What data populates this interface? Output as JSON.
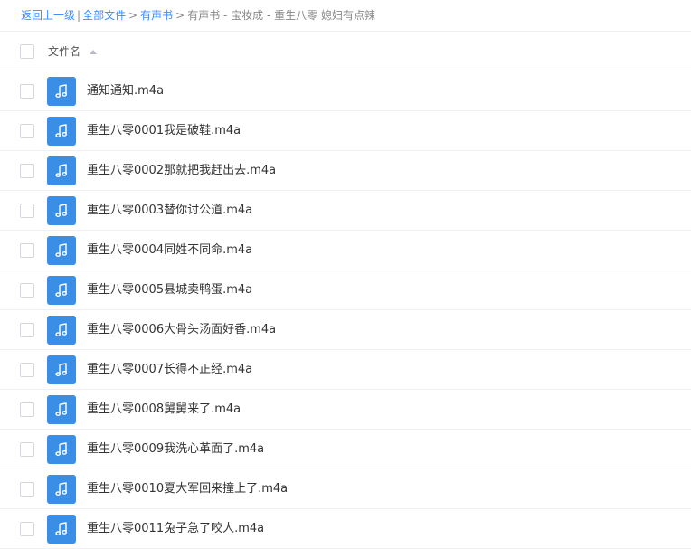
{
  "breadcrumb": {
    "back_label": "返回上一级",
    "separator_pipe": "|",
    "all_files_label": "全部文件",
    "separator": ">",
    "folder_label": "有声书",
    "current_label": "有声书 - 宝妆成 - 重生八零 媳妇有点辣"
  },
  "header": {
    "name_column_label": "文件名"
  },
  "files": [
    {
      "name": "通知通知.m4a",
      "icon": "music-icon"
    },
    {
      "name": "重生八零0001我是破鞋.m4a",
      "icon": "music-icon"
    },
    {
      "name": "重生八零0002那就把我赶出去.m4a",
      "icon": "music-icon"
    },
    {
      "name": "重生八零0003替你讨公道.m4a",
      "icon": "music-icon"
    },
    {
      "name": "重生八零0004同姓不同命.m4a",
      "icon": "music-icon"
    },
    {
      "name": "重生八零0005县城卖鸭蛋.m4a",
      "icon": "music-icon"
    },
    {
      "name": "重生八零0006大骨头汤面好香.m4a",
      "icon": "music-icon"
    },
    {
      "name": "重生八零0007长得不正经.m4a",
      "icon": "music-icon"
    },
    {
      "name": "重生八零0008舅舅来了.m4a",
      "icon": "music-icon"
    },
    {
      "name": "重生八零0009我洗心革面了.m4a",
      "icon": "music-icon"
    },
    {
      "name": "重生八零0010夏大军回来撞上了.m4a",
      "icon": "music-icon"
    },
    {
      "name": "重生八零0011兔子急了咬人.m4a",
      "icon": "music-icon"
    }
  ],
  "colors": {
    "accent": "#3b8cff",
    "file_icon_bg": "#3a8ee6"
  }
}
